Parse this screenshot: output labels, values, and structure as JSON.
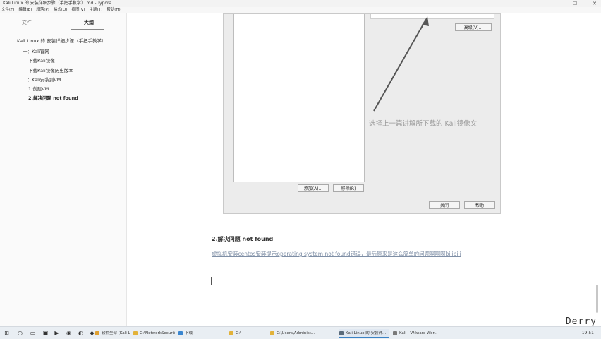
{
  "window": {
    "title": "Kali Linux 的 安装详细步骤（手把手教学）.md - Typora",
    "minimize": "—",
    "maximize": "☐",
    "close": "✕"
  },
  "menu": [
    "文件(F)",
    "编辑(E)",
    "段落(P)",
    "格式(O)",
    "视图(V)",
    "主题(T)",
    "帮助(H)"
  ],
  "sidebar": {
    "tabs": {
      "files": "文件",
      "outline": "大纲"
    },
    "outline": [
      {
        "text": "Kali Linux 的 安装详细步骤（手把手教学）",
        "level": 1
      },
      {
        "text": "一：Kali官网",
        "level": 2
      },
      {
        "text": "下载Kali镜像",
        "level": 3
      },
      {
        "text": "下载Kali镜像历史版本",
        "level": 3
      },
      {
        "text": "二：Kali安装到VM",
        "level": 2
      },
      {
        "text": "1.创建VM",
        "level": 3
      },
      {
        "text": "2.解决问题 not found",
        "level": 3,
        "active": true
      }
    ],
    "bottom_icons": [
      "‹",
      "</>"
    ]
  },
  "dialog": {
    "advanced_button": "高级(V)...",
    "add_button": "添加(A)...",
    "remove_button": "移除(R)",
    "close_button": "关闭",
    "help_button": "帮助"
  },
  "annotation": "选择上一篇讲解所下载的 Kali镜像文",
  "content": {
    "heading": "2.解决问题 not found",
    "link_text": "虚拟机安装centos安装提示operating system not found错误，最后原来是这么简单的问题啊啊啊bilibili"
  },
  "watermark": "Derry",
  "taskbar": {
    "items": [
      {
        "label": "软件全部 (Kali Linux..",
        "color": "#e0a030"
      },
      {
        "label": "G:\\NetworkSecurit...",
        "color": "#e2b23a"
      },
      {
        "label": "下载",
        "color": "#3a86d0"
      },
      {
        "label": "G:\\",
        "color": "#e2b23a"
      },
      {
        "label": "C:\\Users\\Administ...",
        "color": "#e2b23a"
      },
      {
        "label": "Kali Linux 的 安装详...",
        "color": "#5a6b7b",
        "active": true
      },
      {
        "label": "Kali - VMware Wor...",
        "color": "#7a7a7a"
      }
    ],
    "clock": "19:51"
  }
}
